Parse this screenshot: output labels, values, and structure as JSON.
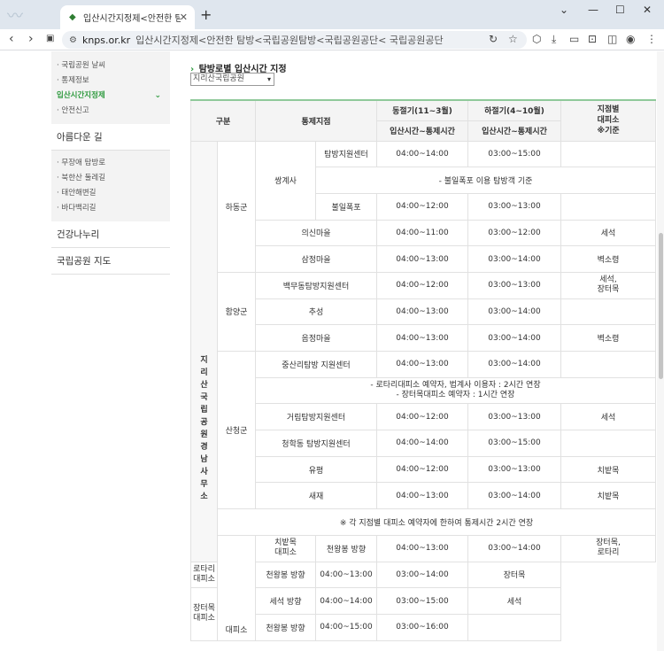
{
  "browser": {
    "tab_title": "입산시간지정제<안전한 탐방<국립공원탐방<국립공원공단< 국립공원공단",
    "tab_title_short": "입산시간지정제<안전한 탐방<",
    "domain": "knps.or.kr",
    "page_title": "입산시간지정제<안전한 탐방<국립공원탐방<국립공원공단< 국립공원공단"
  },
  "sidebar": {
    "sub_items": [
      {
        "label": "· 국립공원 날씨"
      },
      {
        "label": "· 통제정보"
      },
      {
        "label": "입산시간지정제",
        "active": true
      },
      {
        "label": "· 안전신고"
      }
    ],
    "beautiful_road": "아름다운 길",
    "road_items": [
      {
        "label": "· 무장애 탐방로"
      },
      {
        "label": "· 북한산 둘레길"
      },
      {
        "label": "· 태안해변길"
      },
      {
        "label": "· 바다백리길"
      }
    ],
    "health": "건강나누리",
    "map": "국립공원 지도"
  },
  "content": {
    "section_title": "탐방로별 입산시간 지정",
    "park_select": "지리산국립공원",
    "headers": {
      "category": "구분",
      "control_point": "통제지점",
      "winter": "동절기(11~3월)",
      "summer": "하절기(4~10월)",
      "shelter": "지점별\n대피소\n※기준",
      "time_range": "입산시간~통제시간"
    },
    "office": "지리산국립공원경남사무소",
    "groups": {
      "hadong": "하동군",
      "hamyang": "함양군",
      "sancheong": "산청군",
      "shelter": "대피소"
    },
    "rows": {
      "ssanggyesa": "쌍계사",
      "tambang_center": "탐방지원센터",
      "tambang_winter": "04:00~14:00",
      "tambang_summer": "03:00~15:00",
      "bulil_note": "- 불일폭포 이용 탐방객 기준",
      "bulil": "불일폭포",
      "bulil_winter": "04:00~12:00",
      "bulil_summer": "03:00~13:00",
      "uisin": "의신마을",
      "uisin_winter": "04:00~11:00",
      "uisin_summer": "03:00~12:00",
      "uisin_shelter": "세석",
      "samjeong": "삼정마을",
      "samjeong_winter": "04:00~13:00",
      "samjeong_summer": "03:00~14:00",
      "samjeong_shelter": "벽소령",
      "baengmu": "백무동탐방지원센터",
      "baengmu_winter": "04:00~12:00",
      "baengmu_summer": "03:00~13:00",
      "baengmu_shelter": "세석,\n장터목",
      "chuseong": "추성",
      "chuseong_winter": "04:00~13:00",
      "chuseong_summer": "03:00~14:00",
      "eumjeong": "음정마을",
      "eumjeong_winter": "04:00~13:00",
      "eumjeong_summer": "03:00~14:00",
      "eumjeong_shelter": "벽소령",
      "jungsan": "중산리탐방 지원센터",
      "jungsan_winter": "04:00~13:00",
      "jungsan_summer": "03:00~14:00",
      "jungsan_note1": "- 로타리대피소 예약자, 법계사 이용자 : 2시간 연장",
      "jungsan_note2": "- 장터목대피소 예약자 : 1시간 연장",
      "geoim": "거림탐방지원센터",
      "geoim_winter": "04:00~12:00",
      "geoim_summer": "03:00~13:00",
      "geoim_shelter": "세석",
      "cheonghak": "청학동 탐방지원센터",
      "cheonghak_winter": "04:00~14:00",
      "cheonghak_summer": "03:00~15:00",
      "yupyeong": "유평",
      "yupyeong_winter": "04:00~12:00",
      "yupyeong_summer": "03:00~13:00",
      "yupyeong_shelter": "치밭목",
      "saejae": "새재",
      "saejae_winter": "04:00~13:00",
      "saejae_summer": "03:00~14:00",
      "saejae_shelter": "치밭목",
      "extension_note": "※ 각 지점별 대피소 예약자에 한하여 통제시간 2시간 연장",
      "chibat": "치밭목\n대피소",
      "chibat_dir": "천왕봉 방향",
      "chibat_winter": "04:00~13:00",
      "chibat_summer": "03:00~14:00",
      "chibat_shelter": "장터목,\n로타리",
      "rotary": "로타리\n대피소",
      "rotary_dir": "천왕봉 방향",
      "rotary_winter": "04:00~13:00",
      "rotary_summer": "03:00~14:00",
      "rotary_shelter": "장터목",
      "jangteo": "장터목\n대피소",
      "jangteo_dir1": "세석 방향",
      "jangteo_winter1": "04:00~14:00",
      "jangteo_summer1": "03:00~15:00",
      "jangteo_shelter1": "세석",
      "jangteo_dir2": "천왕봉 방향",
      "jangteo_winter2": "04:00~15:00",
      "jangteo_summer2": "03:00~16:00"
    }
  }
}
